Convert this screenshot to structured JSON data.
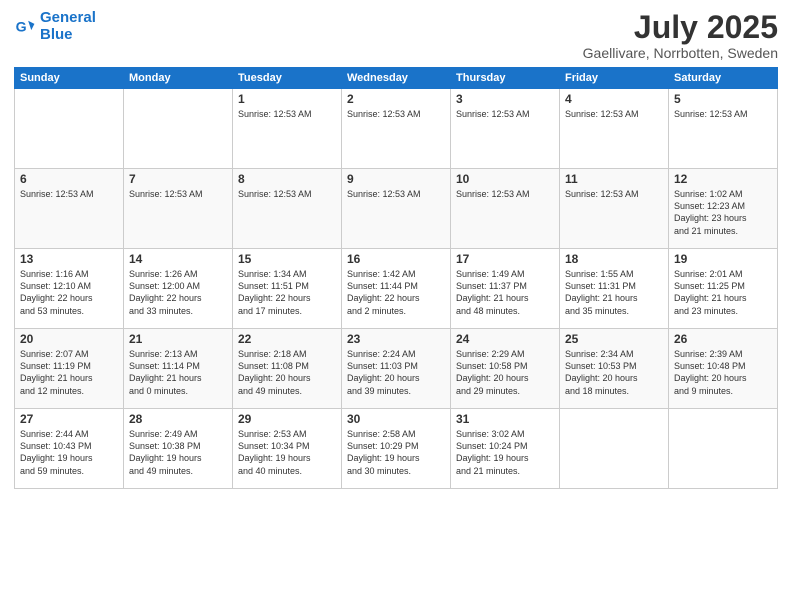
{
  "logo": {
    "line1": "General",
    "line2": "Blue"
  },
  "title": "July 2025",
  "subtitle": "Gaellivare, Norrbotten, Sweden",
  "header": {
    "colors": {
      "blue": "#1a73c9"
    }
  },
  "weekdays": [
    "Sunday",
    "Monday",
    "Tuesday",
    "Wednesday",
    "Thursday",
    "Friday",
    "Saturday"
  ],
  "weeks": [
    {
      "days": [
        {
          "num": "",
          "lines": []
        },
        {
          "num": "",
          "lines": []
        },
        {
          "num": "1",
          "lines": [
            "Sunrise: 12:53 AM",
            "",
            "",
            ""
          ]
        },
        {
          "num": "2",
          "lines": [
            "Sunrise: 12:53 AM",
            "",
            "",
            ""
          ]
        },
        {
          "num": "3",
          "lines": [
            "Sunrise: 12:53 AM",
            "",
            "",
            ""
          ]
        },
        {
          "num": "4",
          "lines": [
            "Sunrise: 12:53 AM",
            "",
            "",
            ""
          ]
        },
        {
          "num": "5",
          "lines": [
            "Sunrise: 12:53 AM",
            "",
            "",
            ""
          ]
        }
      ]
    },
    {
      "days": [
        {
          "num": "6",
          "lines": [
            "Sunrise: 12:53 AM",
            "",
            "",
            ""
          ]
        },
        {
          "num": "7",
          "lines": [
            "Sunrise: 12:53 AM",
            "",
            "",
            ""
          ]
        },
        {
          "num": "8",
          "lines": [
            "Sunrise: 12:53 AM",
            "",
            "",
            ""
          ]
        },
        {
          "num": "9",
          "lines": [
            "Sunrise: 12:53 AM",
            "",
            "",
            ""
          ]
        },
        {
          "num": "10",
          "lines": [
            "Sunrise: 12:53 AM",
            "",
            "",
            ""
          ]
        },
        {
          "num": "11",
          "lines": [
            "Sunrise: 12:53 AM",
            "",
            "",
            ""
          ]
        },
        {
          "num": "12",
          "lines": [
            "Sunrise: 1:02 AM",
            "Sunset: 12:23 AM",
            "Daylight: 23 hours",
            "and 21 minutes."
          ]
        }
      ]
    },
    {
      "days": [
        {
          "num": "13",
          "lines": [
            "Sunrise: 1:16 AM",
            "Sunset: 12:10 AM",
            "Daylight: 22 hours",
            "and 53 minutes."
          ]
        },
        {
          "num": "14",
          "lines": [
            "Sunrise: 1:26 AM",
            "Sunset: 12:00 AM",
            "Daylight: 22 hours",
            "and 33 minutes."
          ]
        },
        {
          "num": "15",
          "lines": [
            "Sunrise: 1:34 AM",
            "Sunset: 11:51 PM",
            "Daylight: 22 hours",
            "and 17 minutes."
          ]
        },
        {
          "num": "16",
          "lines": [
            "Sunrise: 1:42 AM",
            "Sunset: 11:44 PM",
            "Daylight: 22 hours",
            "and 2 minutes."
          ]
        },
        {
          "num": "17",
          "lines": [
            "Sunrise: 1:49 AM",
            "Sunset: 11:37 PM",
            "Daylight: 21 hours",
            "and 48 minutes."
          ]
        },
        {
          "num": "18",
          "lines": [
            "Sunrise: 1:55 AM",
            "Sunset: 11:31 PM",
            "Daylight: 21 hours",
            "and 35 minutes."
          ]
        },
        {
          "num": "19",
          "lines": [
            "Sunrise: 2:01 AM",
            "Sunset: 11:25 PM",
            "Daylight: 21 hours",
            "and 23 minutes."
          ]
        }
      ]
    },
    {
      "days": [
        {
          "num": "20",
          "lines": [
            "Sunrise: 2:07 AM",
            "Sunset: 11:19 PM",
            "Daylight: 21 hours",
            "and 12 minutes."
          ]
        },
        {
          "num": "21",
          "lines": [
            "Sunrise: 2:13 AM",
            "Sunset: 11:14 PM",
            "Daylight: 21 hours",
            "and 0 minutes."
          ]
        },
        {
          "num": "22",
          "lines": [
            "Sunrise: 2:18 AM",
            "Sunset: 11:08 PM",
            "Daylight: 20 hours",
            "and 49 minutes."
          ]
        },
        {
          "num": "23",
          "lines": [
            "Sunrise: 2:24 AM",
            "Sunset: 11:03 PM",
            "Daylight: 20 hours",
            "and 39 minutes."
          ]
        },
        {
          "num": "24",
          "lines": [
            "Sunrise: 2:29 AM",
            "Sunset: 10:58 PM",
            "Daylight: 20 hours",
            "and 29 minutes."
          ]
        },
        {
          "num": "25",
          "lines": [
            "Sunrise: 2:34 AM",
            "Sunset: 10:53 PM",
            "Daylight: 20 hours",
            "and 18 minutes."
          ]
        },
        {
          "num": "26",
          "lines": [
            "Sunrise: 2:39 AM",
            "Sunset: 10:48 PM",
            "Daylight: 20 hours",
            "and 9 minutes."
          ]
        }
      ]
    },
    {
      "days": [
        {
          "num": "27",
          "lines": [
            "Sunrise: 2:44 AM",
            "Sunset: 10:43 PM",
            "Daylight: 19 hours",
            "and 59 minutes."
          ]
        },
        {
          "num": "28",
          "lines": [
            "Sunrise: 2:49 AM",
            "Sunset: 10:38 PM",
            "Daylight: 19 hours",
            "and 49 minutes."
          ]
        },
        {
          "num": "29",
          "lines": [
            "Sunrise: 2:53 AM",
            "Sunset: 10:34 PM",
            "Daylight: 19 hours",
            "and 40 minutes."
          ]
        },
        {
          "num": "30",
          "lines": [
            "Sunrise: 2:58 AM",
            "Sunset: 10:29 PM",
            "Daylight: 19 hours",
            "and 30 minutes."
          ]
        },
        {
          "num": "31",
          "lines": [
            "Sunrise: 3:02 AM",
            "Sunset: 10:24 PM",
            "Daylight: 19 hours",
            "and 21 minutes."
          ]
        },
        {
          "num": "",
          "lines": []
        },
        {
          "num": "",
          "lines": []
        }
      ]
    }
  ]
}
